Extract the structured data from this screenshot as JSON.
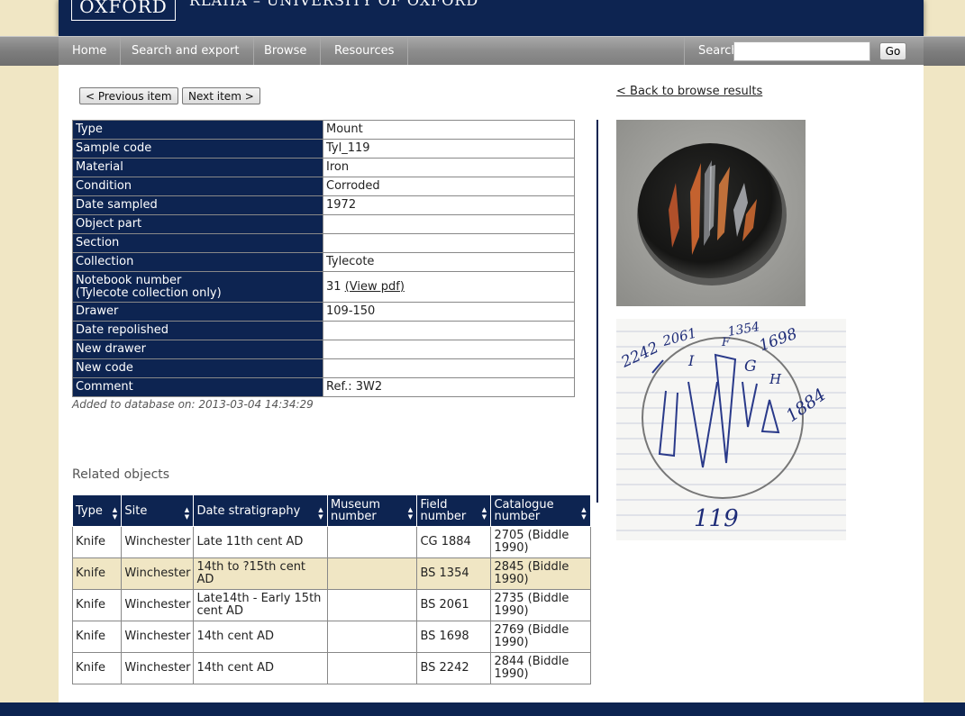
{
  "header": {
    "logo": "OXFORD",
    "site_title": "RLAHA – UNIVERSITY OF OXFORD"
  },
  "nav": {
    "items": [
      "Home",
      "Search and export",
      "Browse",
      "Resources"
    ],
    "search_label": "Search:",
    "search_value": "",
    "go_label": "Go"
  },
  "item_nav": {
    "prev_label": "<  Previous item",
    "next_label": "Next item >",
    "back_label": "< Back to browse results"
  },
  "properties": [
    {
      "key": "Type",
      "value": "Mount"
    },
    {
      "key": "Sample code",
      "value": "Tyl_119"
    },
    {
      "key": "Material",
      "value": "Iron"
    },
    {
      "key": "Condition",
      "value": "Corroded"
    },
    {
      "key": "Date sampled",
      "value": "1972"
    },
    {
      "key": "Object part",
      "value": ""
    },
    {
      "key": "Section",
      "value": ""
    },
    {
      "key": "Collection",
      "value": "Tylecote"
    },
    {
      "key": "Notebook number",
      "key_sub": "(Tylecote collection only)",
      "value": "31",
      "link": "(View pdf)"
    },
    {
      "key": "Drawer",
      "value": "109-150"
    },
    {
      "key": "Date repolished",
      "value": ""
    },
    {
      "key": "New drawer",
      "value": ""
    },
    {
      "key": "New code",
      "value": ""
    },
    {
      "key": "Comment",
      "value": "Ref.: 3W2"
    }
  ],
  "added_text": "Added to database on: 2013-03-04 14:34:29",
  "related": {
    "title": "Related objects",
    "columns": [
      "Type",
      "Site",
      "Date stratigraphy",
      "Museum number",
      "Field number",
      "Catalogue number"
    ],
    "rows": [
      [
        "Knife",
        "Winchester",
        "Late 11th cent AD",
        "",
        "CG 1884",
        "2705 (Biddle 1990)"
      ],
      [
        "Knife",
        "Winchester",
        "14th to ?15th cent AD",
        "",
        "BS 1354",
        "2845 (Biddle 1990)"
      ],
      [
        "Knife",
        "Winchester",
        "Late14th - Early 15th cent AD",
        "",
        "BS 2061",
        "2735 (Biddle 1990)"
      ],
      [
        "Knife",
        "Winchester",
        "14th cent AD",
        "",
        "BS 1698",
        "2769 (Biddle 1990)"
      ],
      [
        "Knife",
        "Winchester",
        "14th cent AD",
        "",
        "BS 2242",
        "2844 (Biddle 1990)"
      ]
    ],
    "highlighted_row": 1
  },
  "sketch": {
    "labels": [
      "2242",
      "2061",
      "1354",
      "1698",
      "1884",
      "119",
      "I",
      "F",
      "G",
      "H"
    ]
  }
}
